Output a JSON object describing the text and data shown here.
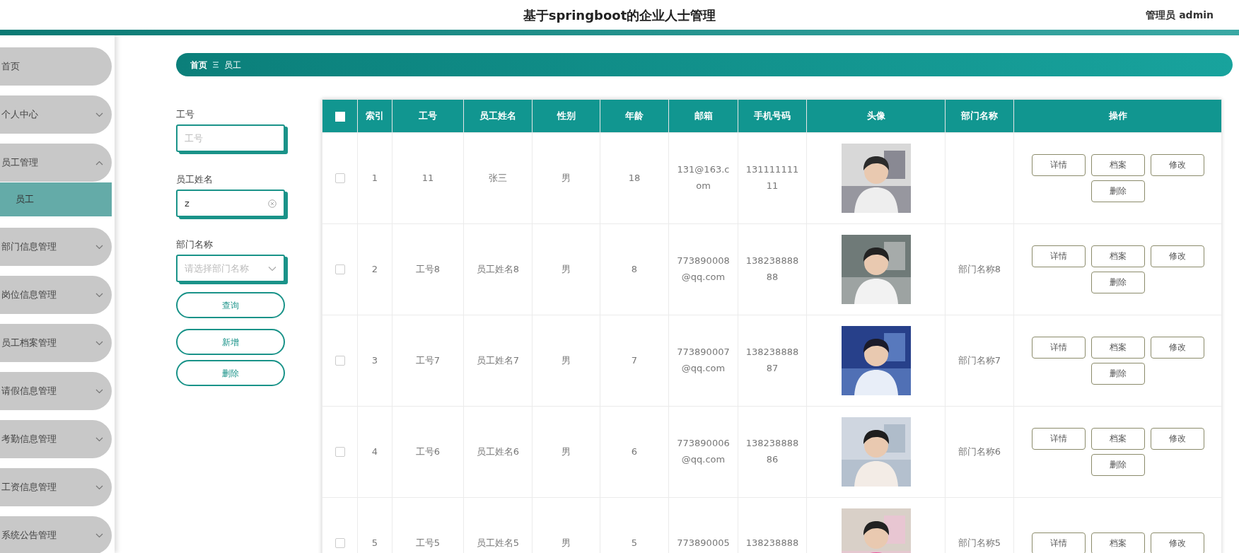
{
  "header": {
    "title": "基于springboot的企业人士管理",
    "user": "管理员 admin"
  },
  "sidebar": {
    "items": [
      {
        "label": "首页",
        "kind": "link"
      },
      {
        "label": "个人中心",
        "kind": "menu",
        "expanded": false
      },
      {
        "label": "员工管理",
        "kind": "menu",
        "expanded": true,
        "children": [
          {
            "label": "员工",
            "selected": true
          }
        ]
      },
      {
        "label": "部门信息管理",
        "kind": "menu",
        "expanded": false
      },
      {
        "label": "岗位信息管理",
        "kind": "menu",
        "expanded": false
      },
      {
        "label": "员工档案管理",
        "kind": "menu",
        "expanded": false
      },
      {
        "label": "请假信息管理",
        "kind": "menu",
        "expanded": false
      },
      {
        "label": "考勤信息管理",
        "kind": "menu",
        "expanded": false
      },
      {
        "label": "工资信息管理",
        "kind": "menu",
        "expanded": false
      },
      {
        "label": "系统公告管理",
        "kind": "menu",
        "expanded": false
      }
    ]
  },
  "breadcrumb": [
    "首页",
    "员工"
  ],
  "search": {
    "fields": [
      {
        "label": "工号",
        "kind": "input",
        "placeholder": "工号"
      },
      {
        "label": "员工姓名",
        "kind": "input",
        "value": "z",
        "clearable": true
      },
      {
        "label": "部门名称",
        "kind": "select",
        "placeholder": "请选择部门名称"
      }
    ],
    "buttons": [
      "查询",
      "新增",
      "删除"
    ]
  },
  "table": {
    "select_all": false,
    "columns": [
      "索引",
      "工号",
      "员工姓名",
      "性别",
      "年龄",
      "邮箱",
      "手机号码",
      "头像",
      "部门名称",
      "操作"
    ],
    "rows": [
      {
        "selected": false,
        "index": "1",
        "id": "11",
        "name": "张三",
        "gender": "男",
        "age": "18",
        "email": "131@163.com",
        "phone": "13111111111",
        "avatar": {
          "kind": "picture"
        },
        "department": "",
        "actions": [
          "详情",
          "档案",
          "修改",
          "删除"
        ]
      },
      {
        "selected": false,
        "index": "2",
        "id": "工号8",
        "name": "员工姓名8",
        "gender": "男",
        "age": "8",
        "email": "773890008@qq.com",
        "phone": "13823888888",
        "avatar": {
          "kind": "picture"
        },
        "department": "部门名称8",
        "actions": [
          "详情",
          "档案",
          "修改",
          "删除"
        ]
      },
      {
        "selected": false,
        "index": "3",
        "id": "工号7",
        "name": "员工姓名7",
        "gender": "男",
        "age": "7",
        "email": "773890007@qq.com",
        "phone": "13823888887",
        "avatar": {
          "kind": "picture"
        },
        "department": "部门名称7",
        "actions": [
          "详情",
          "档案",
          "修改",
          "删除"
        ]
      },
      {
        "selected": false,
        "index": "4",
        "id": "工号6",
        "name": "员工姓名6",
        "gender": "男",
        "age": "6",
        "email": "773890006@qq.com",
        "phone": "13823888886",
        "avatar": {
          "kind": "picture"
        },
        "department": "部门名称6",
        "actions": [
          "详情",
          "档案",
          "修改",
          "删除"
        ]
      },
      {
        "selected": false,
        "index": "5",
        "id": "工号5",
        "name": "员工姓名5",
        "gender": "男",
        "age": "5",
        "email": "773890005",
        "phone": "138238888",
        "avatar": {
          "kind": "picture"
        },
        "department": "部门名称5",
        "actions": [
          "详情",
          "档案",
          "修改"
        ]
      }
    ]
  }
}
